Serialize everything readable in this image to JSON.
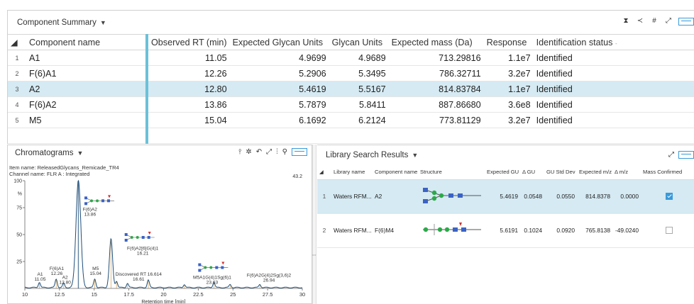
{
  "component_summary": {
    "title": "Component Summary",
    "columns": [
      "Component name",
      "Observed RT (min)",
      "Expected Glycan Units",
      "Glycan Units",
      "Expected mass (Da)",
      "Response",
      "Identification status"
    ],
    "rows": [
      {
        "n": "1",
        "name": "A1",
        "rt": "11.05",
        "egu": "4.9699",
        "gu": "4.9689",
        "mass": "713.29816",
        "resp": "1.1e7",
        "status": "Identified"
      },
      {
        "n": "2",
        "name": "F(6)A1",
        "rt": "12.26",
        "egu": "5.2906",
        "gu": "5.3495",
        "mass": "786.32711",
        "resp": "3.2e7",
        "status": "Identified"
      },
      {
        "n": "3",
        "name": "A2",
        "rt": "12.80",
        "egu": "5.4619",
        "gu": "5.5167",
        "mass": "814.83784",
        "resp": "1.1e7",
        "status": "Identified"
      },
      {
        "n": "4",
        "name": "F(6)A2",
        "rt": "13.86",
        "egu": "5.7879",
        "gu": "5.8411",
        "mass": "887.86680",
        "resp": "3.6e8",
        "status": "Identified"
      },
      {
        "n": "5",
        "name": "M5",
        "rt": "15.04",
        "egu": "6.1692",
        "gu": "6.2124",
        "mass": "773.81129",
        "resp": "3.2e7",
        "status": "Identified"
      }
    ]
  },
  "chromatograms": {
    "title": "Chromatograms",
    "item_name": "Item name: ReleasedGlycans_Remicade_TR4",
    "channel_name": "Channel name: FLR A : Integrated",
    "y_max_label": "43.2",
    "x_axis_label": "Retention time [min]"
  },
  "chart_data": {
    "type": "line",
    "xlabel": "Retention time [min]",
    "ylabel": "%",
    "xlim": [
      10,
      30
    ],
    "ylim": [
      0,
      100
    ],
    "x_ticks": [
      "10",
      "12.5",
      "15",
      "17.5",
      "20",
      "22.5",
      "25",
      "27.5",
      "30"
    ],
    "y_ticks": [
      "100",
      "%",
      "75",
      "50",
      "25"
    ],
    "peaks": [
      {
        "rt": 11.05,
        "height": 5
      },
      {
        "rt": 12.26,
        "height": 8
      },
      {
        "rt": 12.8,
        "height": 4
      },
      {
        "rt": 13.86,
        "height": 100
      },
      {
        "rt": 15.04,
        "height": 8
      },
      {
        "rt": 16.21,
        "height": 45
      },
      {
        "rt": 16.61,
        "height": 6
      },
      {
        "rt": 17.4,
        "height": 4
      },
      {
        "rt": 18.9,
        "height": 7
      },
      {
        "rt": 21.5,
        "height": 3
      },
      {
        "rt": 23.63,
        "height": 5
      },
      {
        "rt": 24.8,
        "height": 3
      },
      {
        "rt": 26.94,
        "height": 3
      }
    ],
    "annotations": [
      {
        "text": "F(6)A2",
        "sub": "13.86",
        "x": 14.7,
        "y": 72
      },
      {
        "text": "F(6)A2[6]G(4)1",
        "sub": "16.21",
        "x": 18.5,
        "y": 36
      },
      {
        "text": "Discovered RT 16.614",
        "sub": "16.61",
        "x": 18.2,
        "y": 12
      },
      {
        "text": "M5A1G(4)1Sg(6)1",
        "sub": "23.63",
        "x": 23.5,
        "y": 9
      },
      {
        "text": "F(6)A2G(4)2Sg(3,6)2",
        "sub": "26.94",
        "x": 27.6,
        "y": 11
      },
      {
        "text": "A1",
        "sub": "11.05",
        "x": 11.1,
        "y": 12
      },
      {
        "text": "F(6)A1",
        "sub": "12.26",
        "x": 12.3,
        "y": 17
      },
      {
        "text": "A2",
        "sub": "12.80",
        "x": 12.9,
        "y": 9
      },
      {
        "text": "M5",
        "sub": "15.04",
        "x": 15.1,
        "y": 17
      }
    ]
  },
  "library": {
    "title": "Library Search Results",
    "columns": [
      "Library name",
      "Component name",
      "Structure",
      "Expected GU",
      "Δ GU",
      "GU Std Dev",
      "Expected m/z",
      "Δ m/z",
      "Mass Confirmed"
    ],
    "rows": [
      {
        "n": "1",
        "lib": "Waters RFM...",
        "comp": "A2",
        "egu": "5.4619",
        "dgu": "0.0548",
        "std": "0.0550",
        "emz": "814.8378",
        "dmz": "0.0000",
        "confirmed": true
      },
      {
        "n": "2",
        "lib": "Waters RFM...",
        "comp": "F(6)M4",
        "egu": "5.6191",
        "dgu": "0.1024",
        "std": "0.0920",
        "emz": "765.8138",
        "dmz": "-49.0240",
        "confirmed": false
      }
    ]
  },
  "colors": {
    "accent": "#3a9ad9",
    "selected_row": "#d5eaf3",
    "trace": "#1f4e79",
    "highlight_fill": "#6cc0d8"
  }
}
